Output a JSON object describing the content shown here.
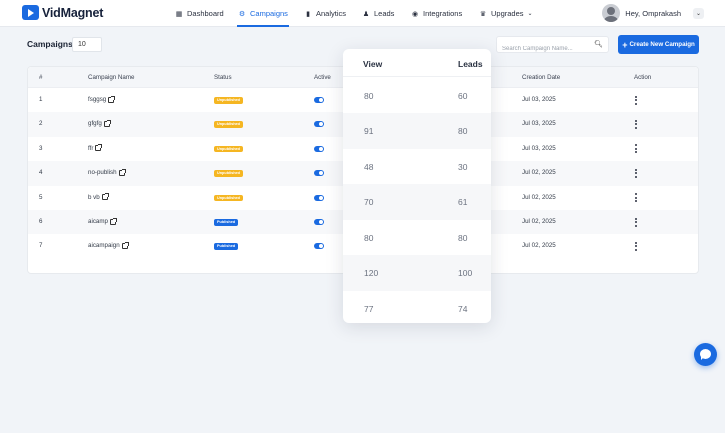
{
  "app": {
    "name": "VidMagnet"
  },
  "nav": {
    "items": [
      {
        "label": "Dashboard",
        "icon": "dashboard-icon"
      },
      {
        "label": "Campaigns",
        "icon": "campaigns-icon",
        "active": true
      },
      {
        "label": "Analytics",
        "icon": "analytics-icon"
      },
      {
        "label": "Leads",
        "icon": "leads-icon"
      },
      {
        "label": "Integrations",
        "icon": "integrations-icon"
      },
      {
        "label": "Upgrades",
        "icon": "upgrades-icon"
      }
    ]
  },
  "user": {
    "greeting": "Hey, Omprakash"
  },
  "toolbar": {
    "title": "Campaigns",
    "page_size": "10",
    "search_placeholder": "Search Campaign Name...",
    "create_label": "Create New Campaign"
  },
  "table": {
    "headers": {
      "index": "#",
      "name": "Campaign Name",
      "status": "Status",
      "active": "Active",
      "created": "Creation Date",
      "action": "Action"
    },
    "rows": [
      {
        "index": "1",
        "name": "fsggsg",
        "status": "Unpublished",
        "created": "Jul 03, 2025"
      },
      {
        "index": "2",
        "name": "gfgfg",
        "status": "Unpublished",
        "created": "Jul 03, 2025"
      },
      {
        "index": "3",
        "name": "ffr",
        "status": "Unpublished",
        "created": "Jul 03, 2025"
      },
      {
        "index": "4",
        "name": "no-publish",
        "status": "Unpublished",
        "created": "Jul 02, 2025"
      },
      {
        "index": "5",
        "name": "b vb",
        "status": "Unpublished",
        "created": "Jul 02, 2025"
      },
      {
        "index": "6",
        "name": "aicamp",
        "status": "Published",
        "created": "Jul 02, 2025"
      },
      {
        "index": "7",
        "name": "aicampaign",
        "status": "Published",
        "created": "Jul 02, 2025"
      }
    ]
  },
  "overlay": {
    "headers": {
      "view": "View",
      "leads": "Leads"
    },
    "rows": [
      {
        "view": "80",
        "leads": "60"
      },
      {
        "view": "91",
        "leads": "80"
      },
      {
        "view": "48",
        "leads": "30"
      },
      {
        "view": "70",
        "leads": "61"
      },
      {
        "view": "80",
        "leads": "80"
      },
      {
        "view": "120",
        "leads": "100"
      },
      {
        "view": "77",
        "leads": "74"
      }
    ]
  },
  "colors": {
    "accent": "#1a6ae0",
    "unpublished": "#f5b622",
    "published": "#1a6ae0"
  }
}
